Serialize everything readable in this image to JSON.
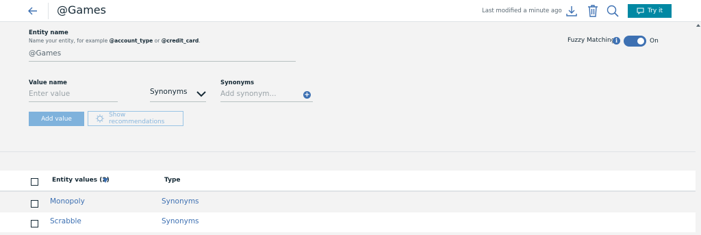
{
  "header": {
    "title": "@Games",
    "last_modified": "Last modified a minute ago",
    "try_it_label": "Try it",
    "icons": [
      "back-arrow-icon",
      "download-icon",
      "trash-icon",
      "search-icon",
      "chat-icon"
    ]
  },
  "entity": {
    "name_label": "Entity name",
    "hint_prefix": "Name your entity, for example ",
    "hint_example1": "@account_type",
    "hint_or": " or ",
    "hint_example2": "@credit_card",
    "hint_suffix": ".",
    "name_value": "@Games",
    "fuzzy_label": "Fuzzy Matching",
    "fuzzy_state": "On"
  },
  "value_form": {
    "value_label": "Value name",
    "value_placeholder": "Enter value",
    "type_selected": "Synonyms",
    "synonyms_label": "Synonyms",
    "synonym_placeholder": "Add synonym...",
    "add_value_label": "Add value",
    "recommendations_label": "Show recommendations"
  },
  "table": {
    "col_values": "Entity values (2)",
    "col_type": "Type",
    "rows": [
      {
        "value": "Monopoly",
        "type": "Synonyms"
      },
      {
        "value": "Scrabble",
        "type": "Synonyms"
      }
    ]
  },
  "colors": {
    "accent": "#3d70b2",
    "try_it": "#0088a3",
    "add_value_disabled": "#7fb2dc"
  }
}
